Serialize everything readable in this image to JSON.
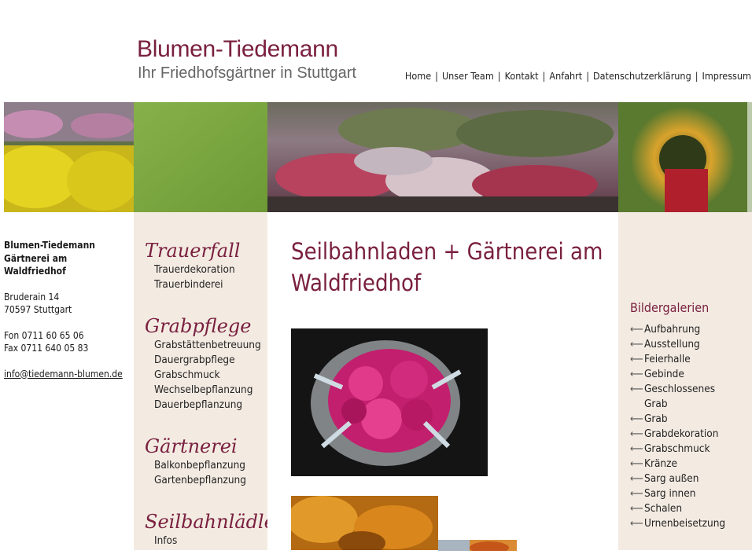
{
  "header": {
    "logo_title": "Blumen-Tiedemann",
    "logo_subtitle": "Ihr Friedhofsgärtner in Stuttgart",
    "nav": [
      "Home",
      "Unser Team",
      "Kontakt",
      "Anfahrt",
      "Datenschutzerklärung",
      "Impressum"
    ]
  },
  "contact": {
    "name_lines": [
      "Blumen-Tiedemann",
      "Gärtnerei am",
      "Waldfriedhof"
    ],
    "street": "Bruderain 14",
    "city": "70597 Stuttgart",
    "phone": "Fon 0711 60 65 06",
    "fax": "Fax 0711 640 05 83",
    "email": "info@tiedemann-blumen.de"
  },
  "sidenav": [
    {
      "heading": "Trauerfall",
      "items": [
        "Trauerdekoration",
        "Trauerbinderei"
      ]
    },
    {
      "heading": "Grabpflege",
      "items": [
        "Grabstättenbetreuung",
        "Dauergrabpflege",
        "Grabschmuck",
        "Wechselbepflanzung",
        "Dauerbepflanzung"
      ]
    },
    {
      "heading": "Gärtnerei",
      "items": [
        "Balkonbepflanzung",
        "Gartenbepflanzung"
      ]
    },
    {
      "heading": "Seilbahnlädle",
      "items": [
        "Infos"
      ]
    }
  ],
  "main": {
    "title": "Seilbahnladen + Gärtnerei am Waldfriedhof"
  },
  "galleries": {
    "title": "Bildergalerien",
    "arrow": "⟵",
    "items": [
      "Aufbahrung",
      "Ausstellung",
      "Feierhalle",
      "Gebinde",
      "Geschlossenes Grab",
      "Grab",
      "Grabdekoration",
      "Grabschmuck",
      "Kränze",
      "Sarg außen",
      "Sarg innen",
      "Schalen",
      "Urnenbeisetzung"
    ]
  },
  "colors": {
    "brand": "#7a2040",
    "side_bg": "#f3ebe2",
    "banner_green": "#7aa640"
  }
}
